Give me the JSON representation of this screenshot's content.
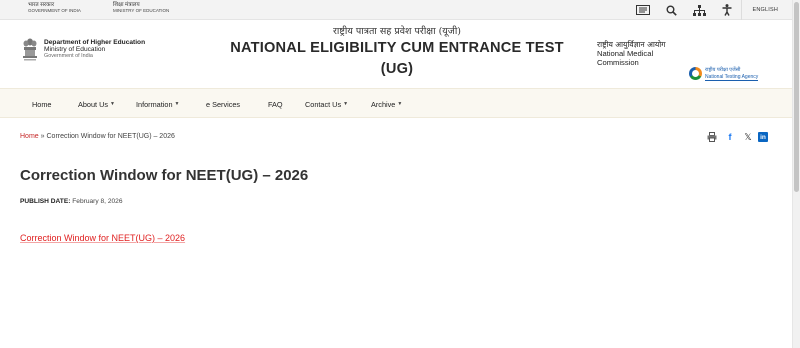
{
  "topbar": {
    "gov_india_hi": "भारत सरकार",
    "gov_india_en": "GOVERNMENT OF INDIA",
    "ministry_hi": "शिक्षा मंत्रालय",
    "ministry_en": "MINISTRY OF EDUCATION",
    "icons": [
      "skip-to-content-icon",
      "search-icon",
      "sitemap-icon",
      "accessibility-icon"
    ],
    "language": "ENGLISH"
  },
  "header": {
    "dept_line1": "Department of Higher Education",
    "dept_line2": "Ministry of Education",
    "dept_line3": "Government of India",
    "title_hindi": "राष्ट्रीय पात्रता सह प्रवेश परीक्षा (यूजी)",
    "title_line1": "NATIONAL ELIGIBILITY CUM ENTRANCE TEST",
    "title_line2": "(UG)",
    "nmc_hindi": "राष्ट्रीय आयुर्विज्ञान आयोग",
    "nmc_line1": "National Medical",
    "nmc_line2": "Commission",
    "nta_hindi": "राष्ट्रीय परीक्षा एजेंसी",
    "nta_english": "National Testing Agency"
  },
  "nav": {
    "items": [
      {
        "label": "Home",
        "dropdown": false
      },
      {
        "label": "About Us",
        "dropdown": true
      },
      {
        "label": "Information",
        "dropdown": true
      },
      {
        "label": "e Services",
        "dropdown": false
      },
      {
        "label": "FAQ",
        "dropdown": false
      },
      {
        "label": "Contact Us",
        "dropdown": true
      },
      {
        "label": "Archive",
        "dropdown": true
      }
    ]
  },
  "breadcrumb": {
    "home": "Home",
    "separator": "»",
    "current": "Correction Window for NEET(UG) – 2026"
  },
  "share_icons": [
    "print-icon",
    "facebook-icon",
    "x-icon",
    "linkedin-icon"
  ],
  "article": {
    "title": "Correction Window for NEET(UG) – 2026",
    "publish_label": "PUBLISH DATE:",
    "publish_date": "February 8, 2026",
    "document_link": "Correction Window for NEET(UG) – 2026"
  },
  "colors": {
    "link_red": "#e02020",
    "nav_bg": "#faf8f1",
    "topbar_bg": "#f3f3f3"
  }
}
